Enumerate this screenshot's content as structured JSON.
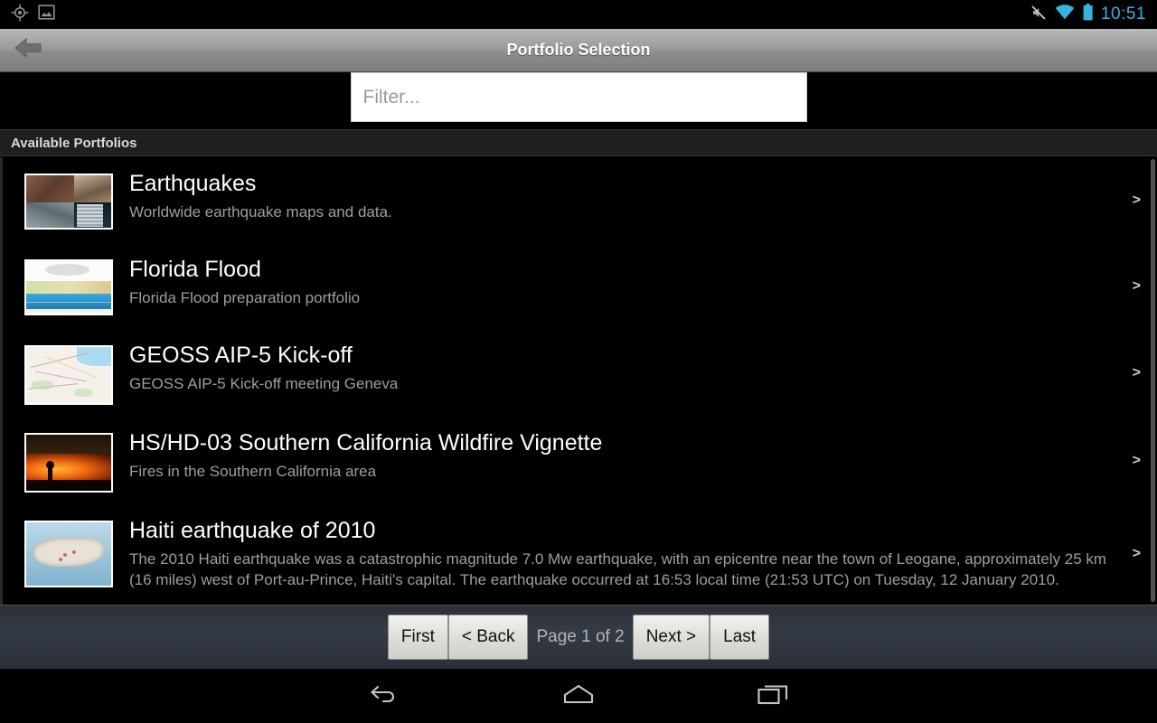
{
  "status_bar": {
    "icons": [
      "location-icon",
      "image-icon"
    ],
    "right_icons": [
      "mute-icon",
      "wifi-icon",
      "battery-icon"
    ],
    "clock": "10:51",
    "accent_color": "#35b4e0"
  },
  "title_bar": {
    "back_icon": "back-arrow-icon",
    "title": "Portfolio Selection"
  },
  "filter": {
    "value": "",
    "placeholder": "Filter..."
  },
  "section": {
    "header": "Available Portfolios"
  },
  "list": {
    "items": [
      {
        "title": "Earthquakes",
        "description": "Worldwide earthquake maps and data.",
        "thumbnail": "earthquake-damage-collage-thumbnail",
        "chevron": ">"
      },
      {
        "title": "Florida Flood",
        "description": "Florida Flood preparation portfolio",
        "thumbnail": "coastal-flood-diagram-thumbnail",
        "chevron": ">"
      },
      {
        "title": "GEOSS AIP-5 Kick-off",
        "description": "GEOSS AIP-5 Kick-off meeting Geneva",
        "thumbnail": "geneva-street-map-thumbnail",
        "chevron": ">"
      },
      {
        "title": "HS/HD-03 Southern California Wildfire Vignette",
        "description": "Fires in the Southern California area",
        "thumbnail": "wildfire-night-photo-thumbnail",
        "chevron": ">"
      },
      {
        "title": "Haiti earthquake of 2010",
        "description": "The 2010 Haiti earthquake was a catastrophic magnitude 7.0 Mw earthquake, with an epicentre near the town of Leogane, approximately 25 km (16 miles) west of Port-au-Prince, Haiti's capital. The earthquake occurred at 16:53 local time (21:53 UTC) on Tuesday, 12 January 2010.",
        "thumbnail": "haiti-island-map-thumbnail",
        "chevron": ">"
      }
    ]
  },
  "pagination": {
    "first_label": "First",
    "back_label": "< Back",
    "page_label": "Page 1 of 2",
    "next_label": "Next >",
    "last_label": "Last"
  },
  "nav_bar": {
    "back": "nav-back-icon",
    "home": "nav-home-icon",
    "recents": "nav-recents-icon"
  }
}
